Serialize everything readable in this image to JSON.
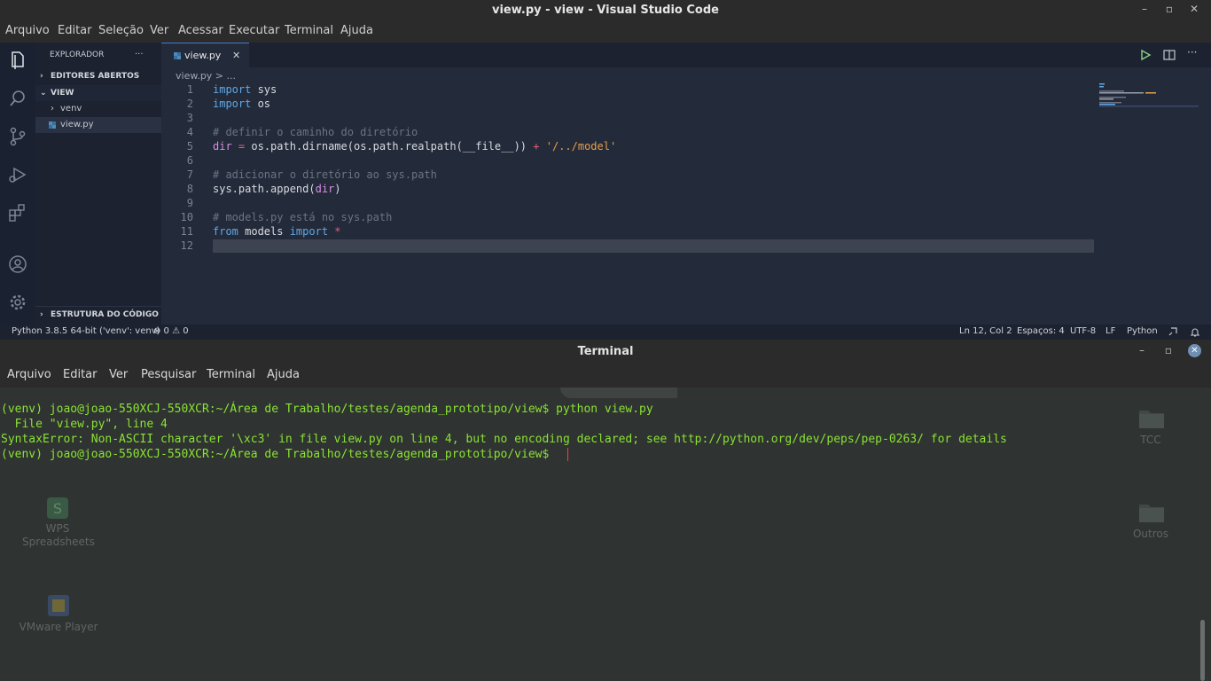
{
  "vscode": {
    "window_title": "view.py - view - Visual Studio Code",
    "menu": [
      "Arquivo",
      "Editar",
      "Seleção",
      "Ver",
      "Acessar",
      "Executar",
      "Terminal",
      "Ajuda"
    ],
    "sidebar": {
      "header": "EXPLORADOR",
      "more": "···",
      "open_editors": "EDITORES ABERTOS",
      "folder": "VIEW",
      "items": [
        "venv",
        "view.py"
      ],
      "outline": "ESTRUTURA DO CÓDIGO"
    },
    "tab": {
      "label": "view.py",
      "close": "✕"
    },
    "breadcrumb": "view.py > ...",
    "code_lines": [
      {
        "n": "1",
        "segments": [
          {
            "t": "import",
            "c": "kw"
          },
          {
            "t": " sys",
            "c": ""
          }
        ]
      },
      {
        "n": "2",
        "segments": [
          {
            "t": "import",
            "c": "kw"
          },
          {
            "t": " os",
            "c": ""
          }
        ]
      },
      {
        "n": "3",
        "segments": []
      },
      {
        "n": "4",
        "segments": [
          {
            "t": "# definir o caminho do diretório",
            "c": "cm"
          }
        ]
      },
      {
        "n": "5",
        "segments": [
          {
            "t": "dir",
            "c": "vr"
          },
          {
            "t": " = ",
            "c": "op"
          },
          {
            "t": "os.path.dirname(os.path.realpath(__file__)) ",
            "c": ""
          },
          {
            "t": "+",
            "c": "op"
          },
          {
            "t": " '/../model'",
            "c": "str"
          }
        ]
      },
      {
        "n": "6",
        "segments": []
      },
      {
        "n": "7",
        "segments": [
          {
            "t": "# adicionar o diretório ao sys.path",
            "c": "cm"
          }
        ]
      },
      {
        "n": "8",
        "segments": [
          {
            "t": "sys.path.append(",
            "c": ""
          },
          {
            "t": "dir",
            "c": "vr"
          },
          {
            "t": ")",
            "c": ""
          }
        ]
      },
      {
        "n": "9",
        "segments": []
      },
      {
        "n": "10",
        "segments": [
          {
            "t": "# models.py está no sys.path",
            "c": "cm"
          }
        ]
      },
      {
        "n": "11",
        "segments": [
          {
            "t": "from",
            "c": "kw"
          },
          {
            "t": " models ",
            "c": ""
          },
          {
            "t": "import",
            "c": "kw"
          },
          {
            "t": " *",
            "c": "op"
          }
        ]
      },
      {
        "n": "12",
        "segments": []
      }
    ],
    "status": {
      "interpreter": "Python 3.8.5 64-bit ('venv': venv)",
      "problems": "⊗ 0 ⚠ 0",
      "position": "Ln 12, Col 2",
      "spaces": "Espaços: 4",
      "encoding": "UTF-8",
      "eol": "LF",
      "language": "Python"
    },
    "colors": {
      "accent": "#3b7dd8",
      "background": "#232a39"
    }
  },
  "terminal": {
    "window_title": "Terminal",
    "menu": [
      "Arquivo",
      "Editar",
      "Ver",
      "Pesquisar",
      "Terminal",
      "Ajuda"
    ],
    "lines": [
      "(venv) joao@joao-550XCJ-550XCR:~/Área de Trabalho/testes/agenda_prototipo/view$ python view.py",
      "  File \"view.py\", line 4",
      "SyntaxError: Non-ASCII character '\\xc3' in file view.py on line 4, but no encoding declared; see http://python.org/dev/peps/pep-0263/ for details",
      "(venv) joao@joao-550XCJ-550XCR:~/Área de Trabalho/testes/agenda_prototipo/view$ "
    ],
    "text_color": "#8ae234"
  },
  "desktop": {
    "icons": [
      "WPS Spreadsheets",
      "VMware Player",
      "TCC",
      "Outros"
    ]
  }
}
